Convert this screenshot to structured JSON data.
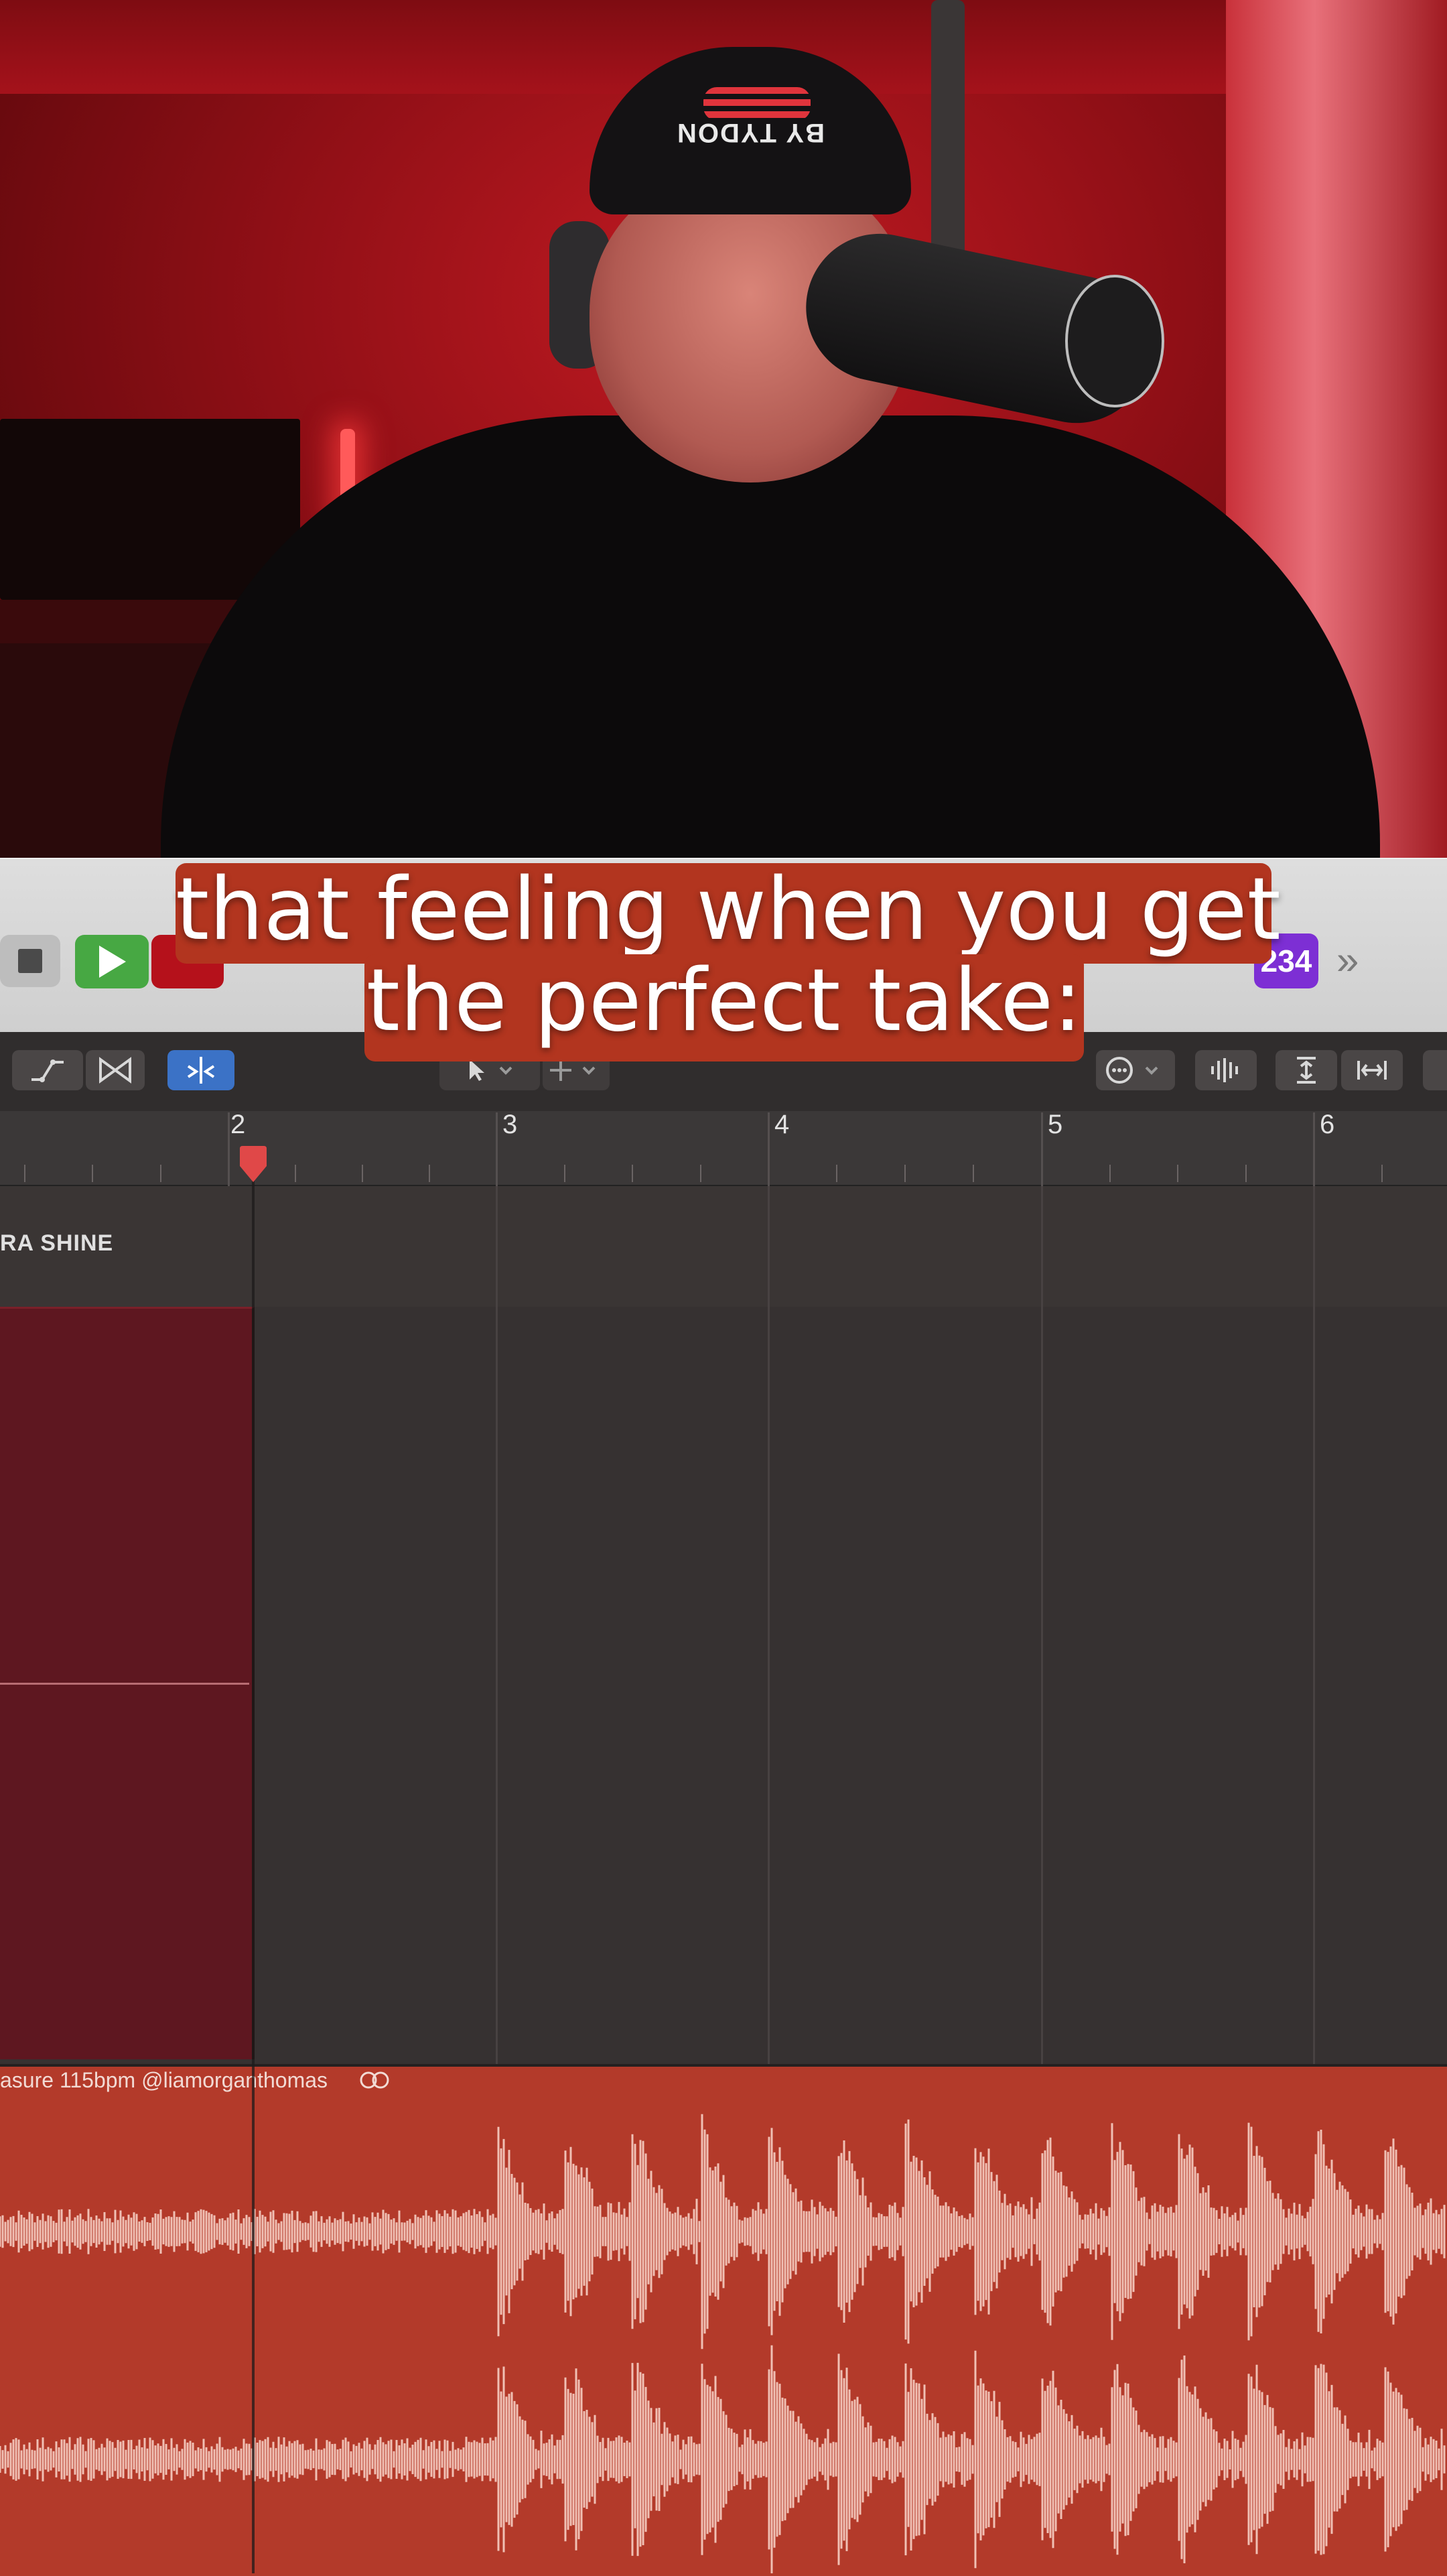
{
  "caption": {
    "line1": "that feeling when you get",
    "line2": "the perfect take:"
  },
  "video": {
    "cap_text": "BY TYDON"
  },
  "toolbar": {
    "counter_label": "234",
    "more_label": "»"
  },
  "ruler": {
    "bars": [
      "2",
      "3",
      "4",
      "5",
      "6"
    ]
  },
  "track": {
    "name": "RA SHINE"
  },
  "audio_region": {
    "title": "asure 115bpm @liamorganthomas"
  },
  "colors": {
    "play": "#47a843",
    "record": "#b5111b",
    "counter": "#7d2fd4",
    "caption_bg": "#b2351f",
    "audio_region": "#b33a2a",
    "waveform": "#f0c0b4"
  }
}
